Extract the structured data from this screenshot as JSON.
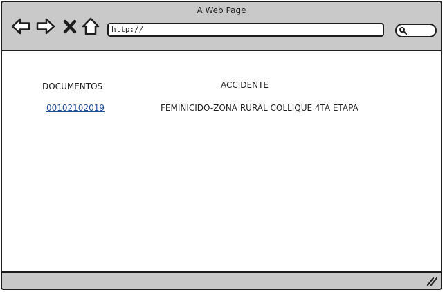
{
  "window": {
    "title": "A Web Page",
    "address_bar": {
      "value": "http://"
    }
  },
  "table": {
    "headers": {
      "documentos": "DOCUMENTOS",
      "accidente": "ACCIDENTE"
    },
    "rows": [
      {
        "documento": "00102102019",
        "accidente": "FEMINICIDO-ZONA RURAL COLLIQUE 4TA ETAPA"
      }
    ]
  },
  "icons": [
    "back-arrow-icon",
    "forward-arrow-icon",
    "close-icon",
    "home-icon",
    "search-icon",
    "resize-grip-icon"
  ],
  "colors": {
    "chrome": "#c9c9c9",
    "border": "#1e1e1e",
    "link": "#1f4f9c"
  }
}
